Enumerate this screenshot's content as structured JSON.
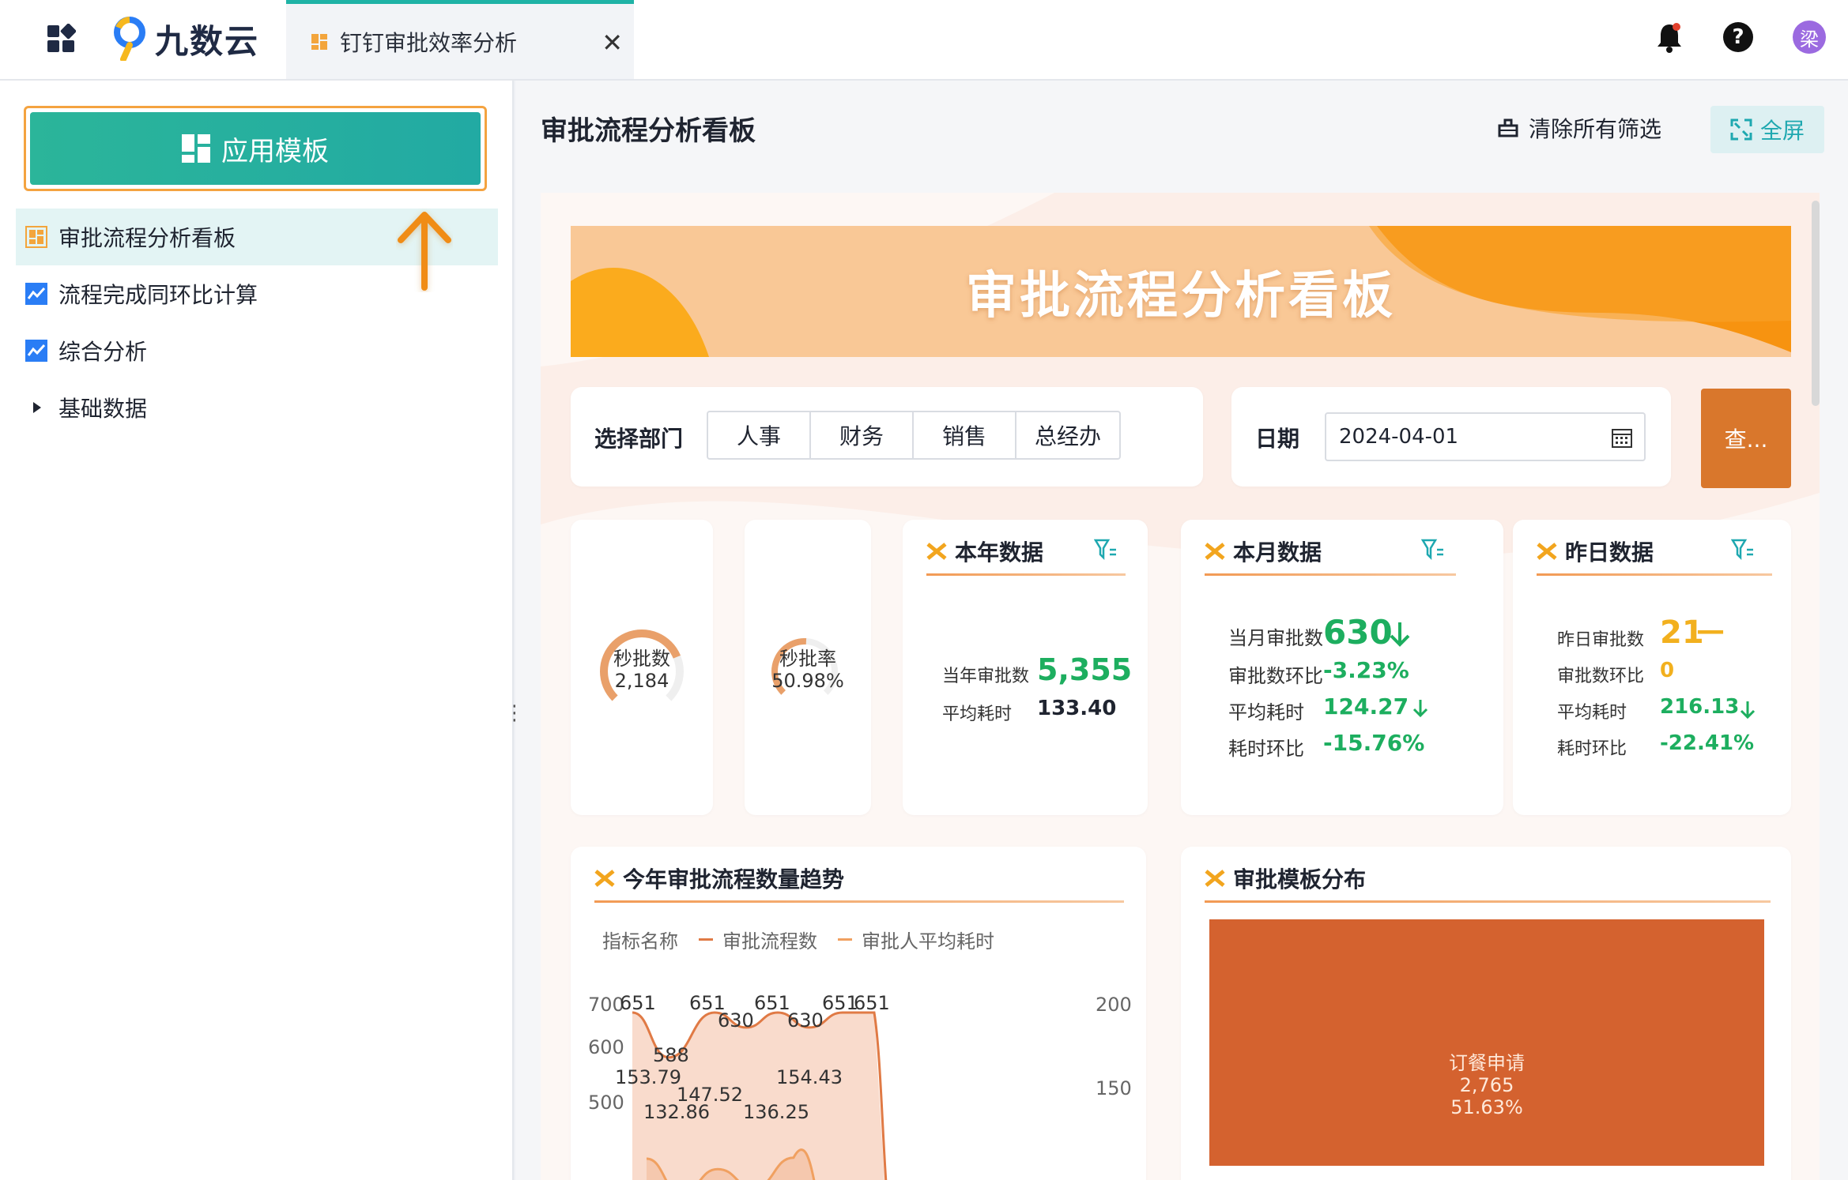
{
  "app": {
    "logo_text": "九数云"
  },
  "tab": {
    "label": "钉钉审批效率分析"
  },
  "user": {
    "avatar_text": "梁"
  },
  "sidebar": {
    "template_button": "应用模板",
    "items": [
      {
        "label": "审批流程分析看板",
        "active": true
      },
      {
        "label": "流程完成同环比计算"
      },
      {
        "label": "综合分析"
      },
      {
        "label": "基础数据"
      }
    ]
  },
  "header": {
    "title": "审批流程分析看板",
    "clear_filters": "清除所有筛选",
    "fullscreen": "全屏"
  },
  "dashboard": {
    "banner_title": "审批流程分析看板",
    "dept_label": "选择部门",
    "departments": [
      "人事",
      "财务",
      "销售",
      "总经办"
    ],
    "date_label": "日期",
    "date_value": "2024-04-01",
    "query_button": "查...",
    "gauges": [
      {
        "label": "秒批数",
        "value": "2,184",
        "fraction": 0.75
      },
      {
        "label": "秒批率",
        "value": "50.98%",
        "fraction": 0.51
      }
    ],
    "year_card": {
      "title": "本年数据",
      "count_label": "当年审批数",
      "count_value": "5,355",
      "avg_label": "平均耗时",
      "avg_value": "133.40"
    },
    "month_card": {
      "title": "本月数据",
      "count_label": "当月审批数",
      "count_value": "630",
      "ratio_label": "审批数环比",
      "ratio_value": "-3.23%",
      "avg_label": "平均耗时",
      "avg_value": "124.27",
      "avg_ratio_label": "耗时环比",
      "avg_ratio_value": "-15.76%"
    },
    "yesterday_card": {
      "title": "昨日数据",
      "count_label": "昨日审批数",
      "count_value": "21",
      "count_trend": "—",
      "ratio_label": "审批数环比",
      "ratio_value": "0",
      "avg_label": "平均耗时",
      "avg_value": "216.13",
      "avg_ratio_label": "耗时环比",
      "avg_ratio_value": "-22.41%"
    },
    "trend_card": {
      "title": "今年审批流程数量趋势"
    },
    "template_card": {
      "title": "审批模板分布",
      "top_item": {
        "name": "订餐申请",
        "value": "2,765",
        "percent": "51.63%"
      }
    }
  },
  "chart_data": {
    "type": "area",
    "legend_title": "指标名称",
    "series": [
      {
        "name": "审批流程数",
        "axis": "left",
        "color": "#e07a45",
        "values": [
          651,
          588,
          651,
          630,
          651,
          630,
          651,
          651
        ]
      },
      {
        "name": "审批人平均耗时",
        "axis": "right",
        "color": "#f0a060",
        "values": [
          153.79,
          132.86,
          147.52,
          136.25,
          154.43
        ]
      }
    ],
    "left_ticks": [
      "700",
      "600",
      "500"
    ],
    "right_ticks": [
      "200",
      "150"
    ],
    "visible_labels_left": [
      "651",
      "588",
      "651",
      "630",
      "651",
      "630",
      "651",
      "651"
    ],
    "visible_labels_right": [
      "153.79",
      "132.86",
      "147.52",
      "136.25",
      "154.43"
    ]
  },
  "colors": {
    "accent_teal": "#22aaa3",
    "accent_orange": "#d9772c",
    "positive_green": "#1dae5f",
    "warning_gold": "#f2b01e"
  }
}
